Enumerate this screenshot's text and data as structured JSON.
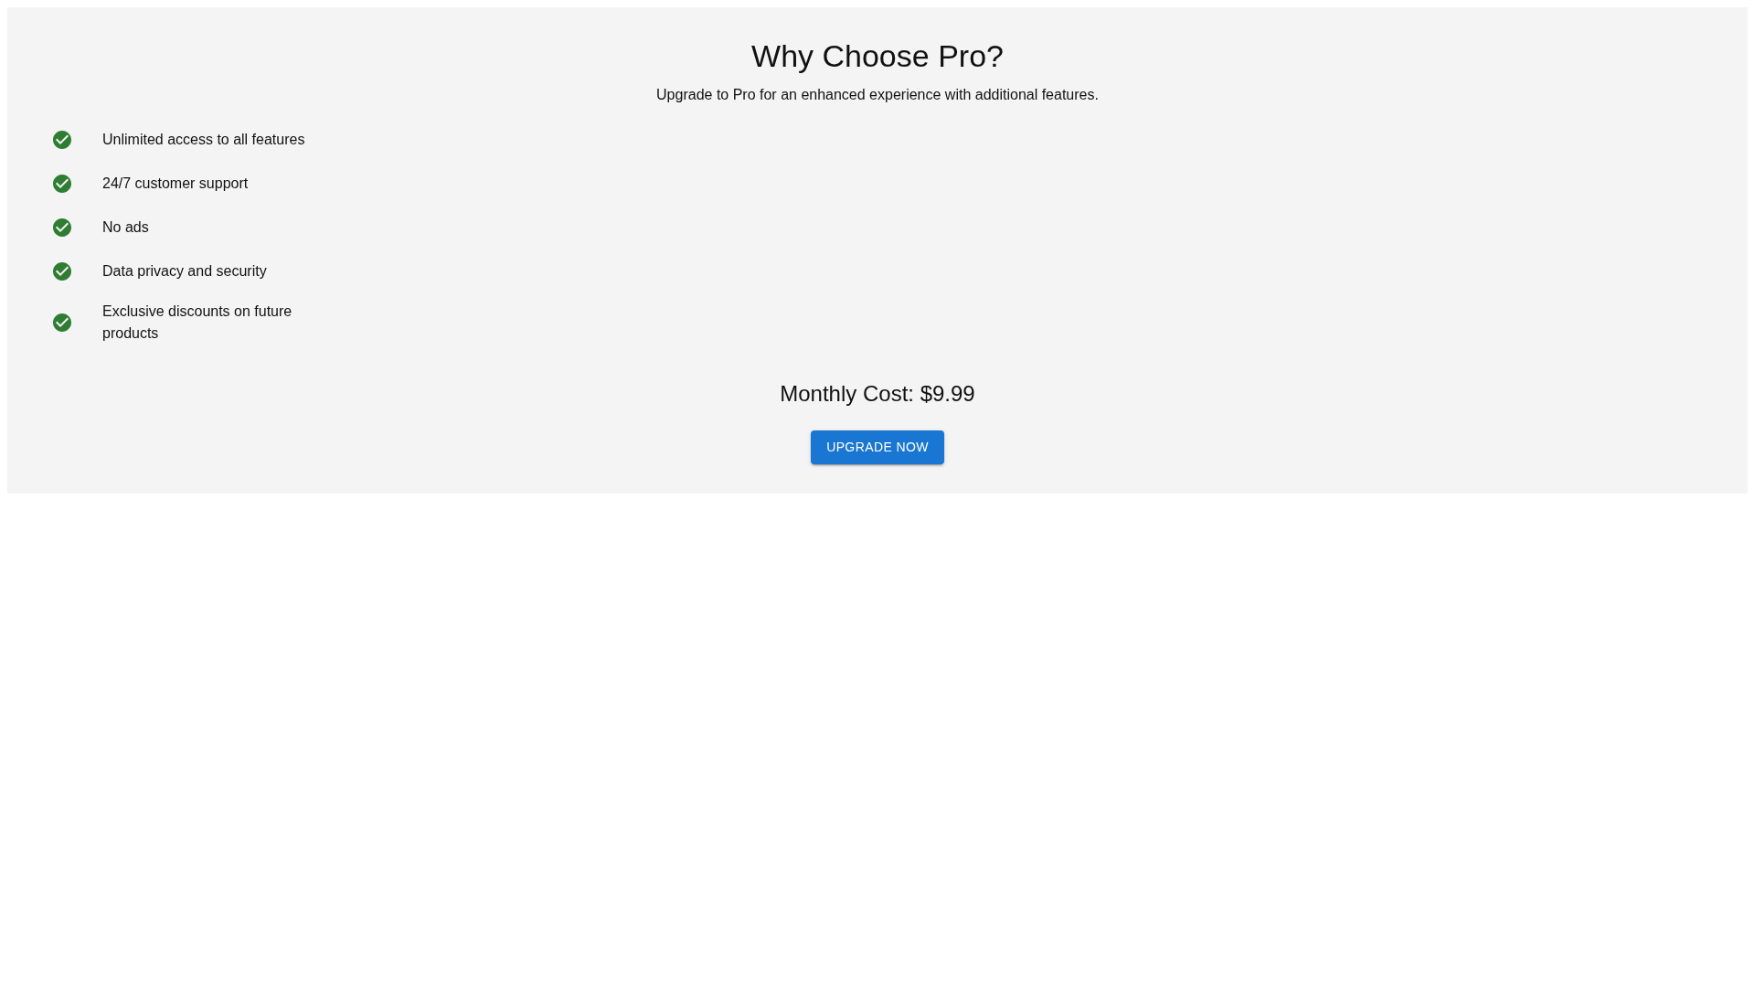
{
  "title": "Why Choose Pro?",
  "subtitle": "Upgrade to Pro for an enhanced experience with additional features.",
  "features": [
    {
      "label": "Unlimited access to all features"
    },
    {
      "label": "24/7 customer support"
    },
    {
      "label": "No ads"
    },
    {
      "label": "Data privacy and security"
    },
    {
      "label": "Exclusive discounts on future products"
    }
  ],
  "price": "Monthly Cost: $9.99",
  "button": "UPGRADE NOW"
}
